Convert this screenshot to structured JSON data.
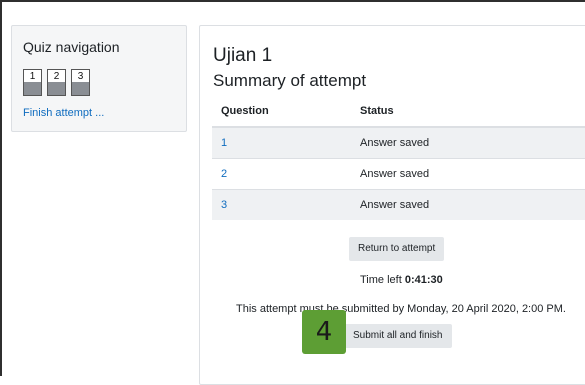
{
  "quiz_nav": {
    "title": "Quiz navigation",
    "questions": [
      "1",
      "2",
      "3"
    ],
    "finish_link": "Finish attempt ..."
  },
  "main": {
    "title": "Ujian 1",
    "subtitle": "Summary of attempt",
    "table": {
      "headers": [
        "Question",
        "Status"
      ],
      "rows": [
        {
          "question": "1",
          "status": "Answer saved"
        },
        {
          "question": "2",
          "status": "Answer saved"
        },
        {
          "question": "3",
          "status": "Answer saved"
        }
      ]
    },
    "return_button": "Return to attempt",
    "time_left_label": "Time left",
    "time_left_value": "0:41:30",
    "deadline_text": "This attempt must be submitted by Monday, 20 April 2020, 2:00 PM.",
    "submit_button": "Submit all and finish"
  },
  "step_badge": "4",
  "colors": {
    "link": "#0f6cbf",
    "step_badge": "#5d9e34",
    "button_bg": "#e4e7ea",
    "row_stripe": "#eff1f3"
  }
}
